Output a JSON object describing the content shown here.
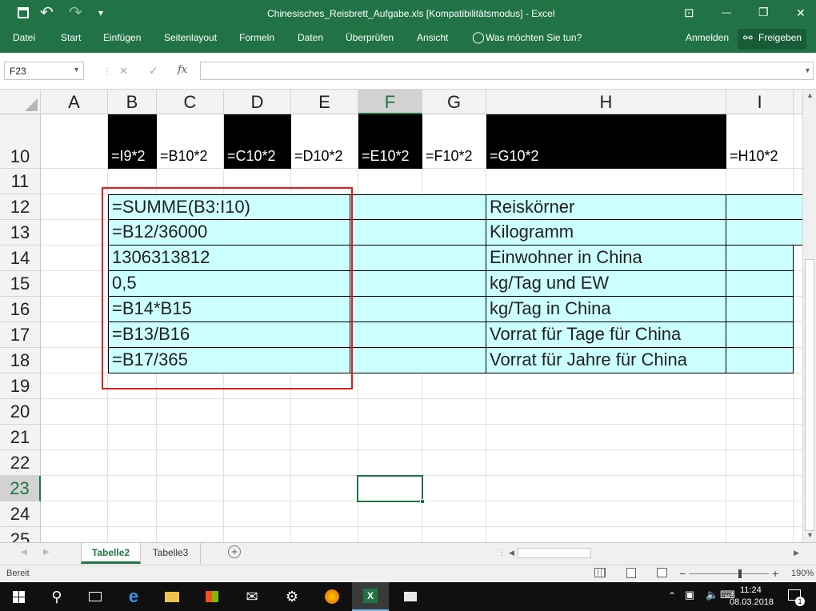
{
  "window": {
    "title": "Chinesisches_Reisbrett_Aufgabe.xls  [Kompatibilitätsmodus]  -  Excel",
    "undo": "↶",
    "redo": "↷",
    "customize": "▾",
    "ribbon_opts": "⊡",
    "minimize": "—",
    "restore": "❐",
    "close": "✕"
  },
  "ribbon": {
    "tabs": [
      "Datei",
      "Start",
      "Einfügen",
      "Seitenlayout",
      "Formeln",
      "Daten",
      "Überprüfen",
      "Ansicht",
      "Was möchten Sie tun?"
    ],
    "signin": "Anmelden",
    "share": "Freigeben"
  },
  "formula_bar": {
    "name_box": "F23",
    "cancel": "✕",
    "enter": "✓",
    "fx": "fx",
    "formula": ""
  },
  "columns": [
    "A",
    "B",
    "C",
    "D",
    "E",
    "F",
    "G",
    "H",
    "I"
  ],
  "rows": [
    "10",
    "11",
    "12",
    "13",
    "14",
    "15",
    "16",
    "17",
    "18",
    "19",
    "20",
    "21",
    "22",
    "23",
    "24",
    "25"
  ],
  "selected_column": "F",
  "selected_row": "23",
  "row10": [
    "=I9*2",
    "=B10*2",
    "=C10*2",
    "=D10*2",
    "=E10*2",
    "=F10*2",
    "=G10*2",
    "=H10*2"
  ],
  "cells": {
    "b12": "=SUMME(B3:I10)",
    "b13": "=B12/36000",
    "b14": "1306313812",
    "b15": "0,5",
    "b16": "=B14*B15",
    "b17": "=B13/B16",
    "b18": "=B17/365",
    "h12": "Reiskörner",
    "h13": "Kilogramm",
    "h14": "Einwohner in China",
    "h15": "kg/Tag und EW",
    "h16": "kg/Tag in China",
    "h17": "Vorrat für Tage für China",
    "h18": "Vorrat für Jahre für China"
  },
  "sheets": {
    "tabs": [
      "Tabelle2",
      "Tabelle3"
    ],
    "active": "Tabelle2",
    "add": "+"
  },
  "status": {
    "mode": "Bereit",
    "zoom": "190%",
    "minus": "−",
    "plus": "+"
  },
  "taskbar": {
    "time": "11:24",
    "date": "08.03.2018",
    "notifications": "1"
  },
  "colors": {
    "excel_green": "#217346",
    "cyan_fill": "#ccffff",
    "highlight_red": "#e01c1c"
  }
}
